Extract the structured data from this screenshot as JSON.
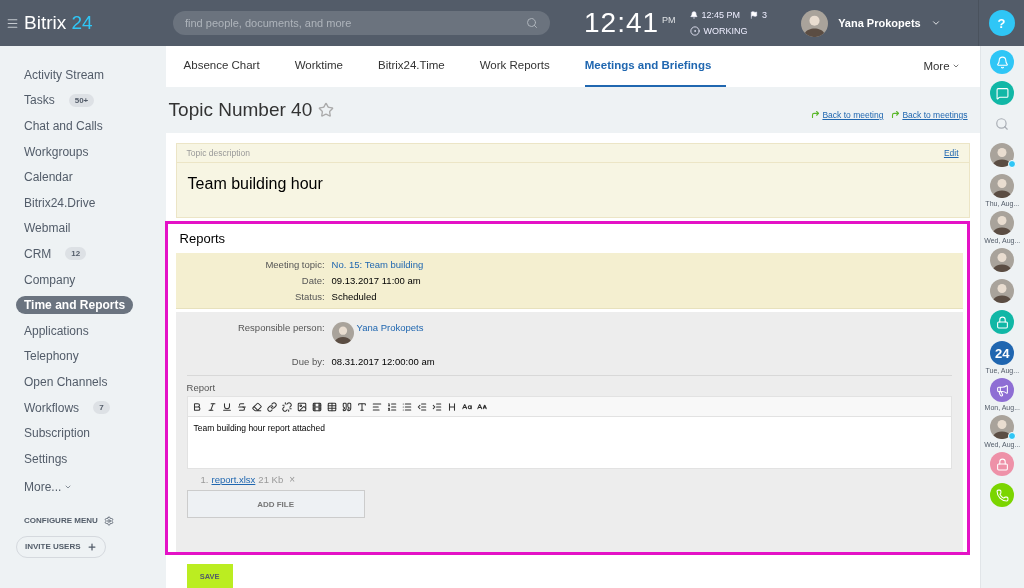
{
  "header": {
    "logo_text": "Bitrix",
    "logo_number": "24",
    "search": {
      "placeholder": "find people, documents, and more"
    },
    "time": "12:41",
    "time_suffix": "PM",
    "alarm": "12:45 PM",
    "flag_count": "3",
    "status": "WORKING",
    "user_name": "Yana Prokopets",
    "help": "?"
  },
  "sidebar": {
    "items": [
      {
        "label": "Activity Stream",
        "selected": false
      },
      {
        "label": "Tasks",
        "badge": "50+",
        "selected": false
      },
      {
        "label": "Chat and Calls",
        "selected": false
      },
      {
        "label": "Workgroups",
        "selected": false
      },
      {
        "label": "Calendar",
        "selected": false
      },
      {
        "label": "Bitrix24.Drive",
        "selected": false
      },
      {
        "label": "Webmail",
        "selected": false
      },
      {
        "label": "CRM",
        "badge": "12",
        "selected": false
      },
      {
        "label": "Company",
        "selected": false
      },
      {
        "label": "Time and Reports",
        "selected": true
      },
      {
        "label": "Applications",
        "selected": false
      },
      {
        "label": "Telephony",
        "selected": false
      },
      {
        "label": "Open Channels",
        "selected": false
      },
      {
        "label": "Workflows",
        "badge": "7",
        "selected": false
      },
      {
        "label": "Subscription",
        "selected": false
      },
      {
        "label": "Settings",
        "selected": false
      }
    ],
    "more": "More...",
    "configure": "CONFIGURE MENU",
    "invite": "INVITE USERS"
  },
  "tabs": [
    {
      "label": "Absence Chart",
      "selected": false
    },
    {
      "label": "Worktime",
      "selected": false
    },
    {
      "label": "Bitrix24.Time",
      "selected": false
    },
    {
      "label": "Work Reports",
      "selected": false
    },
    {
      "label": "Meetings and Briefings",
      "selected": true
    }
  ],
  "tabs_more": "More",
  "page": {
    "title": "Topic Number 40",
    "back_links": [
      "Back to meeting",
      "Back to meetings"
    ]
  },
  "topic": {
    "label": "Topic description",
    "edit": "Edit",
    "text": "Team building hour"
  },
  "reports": {
    "title": "Reports",
    "info_rows": [
      {
        "label": "Meeting topic:",
        "value": "No. 15: Team building",
        "kind": "link"
      },
      {
        "label": "Date:",
        "value": "09.13.2017 11:00 am",
        "kind": "text"
      },
      {
        "label": "Status:",
        "value": "Scheduled",
        "kind": "text"
      }
    ],
    "person": {
      "label": "Responsible person:",
      "name": "Yana Prokopets"
    },
    "due": {
      "label": "Due by:",
      "value": "08.31.2017 12:00:00 am"
    },
    "editor": {
      "label": "Report",
      "text": "Team building hour report attached"
    },
    "file": {
      "index": "1.",
      "name": "report.xlsx",
      "size": "21 Kb",
      "remove": "×"
    },
    "add_file": "ADD FILE"
  },
  "save": "SAVE",
  "rail": [
    {
      "kind": "bell",
      "color": "#2fc6f6"
    },
    {
      "kind": "chat",
      "color": "#11b7a6"
    },
    {
      "kind": "search"
    },
    {
      "kind": "avatar",
      "online": true
    },
    {
      "kind": "avatar",
      "online": false,
      "caption": "Thu, Aug..."
    },
    {
      "kind": "avatar",
      "online": false,
      "caption": "Wed, Aug..."
    },
    {
      "kind": "avatar",
      "online": false
    },
    {
      "kind": "avatar",
      "online": false
    },
    {
      "kind": "lock",
      "color": "#11b7a6"
    },
    {
      "kind": "brand",
      "color": "#2066b0",
      "text": "24",
      "caption": "Tue, Aug..."
    },
    {
      "kind": "megaphone",
      "color": "#8e6ed4",
      "caption": "Mon, Aug..."
    },
    {
      "kind": "avatar",
      "online": true,
      "caption": "Wed, Aug..."
    },
    {
      "kind": "lock",
      "color": "#ee91a8"
    },
    {
      "kind": "phone",
      "color": "#7bd500"
    }
  ]
}
